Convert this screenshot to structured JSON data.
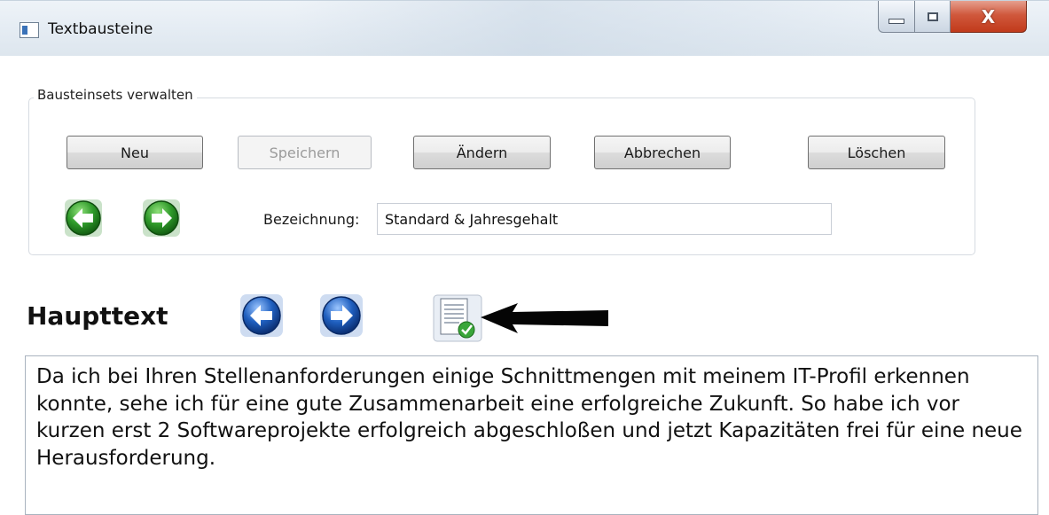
{
  "window": {
    "title": "Textbausteine",
    "close_glyph": "X"
  },
  "group": {
    "label": "Bausteinsets verwalten",
    "buttons": {
      "new": "Neu",
      "save": "Speichern",
      "edit": "Ändern",
      "cancel": "Abbrechen",
      "delete": "Löschen"
    },
    "name_label": "Bezeichnung:",
    "name_value": "Standard & Jahresgehalt",
    "nav_icons": [
      "arrow-left-green-icon",
      "arrow-right-green-icon"
    ]
  },
  "main": {
    "heading": "Haupttext",
    "nav_icons": [
      "arrow-left-blue-icon",
      "arrow-right-blue-icon"
    ],
    "doc_icon": "document-check-icon",
    "body_text": "Da ich bei Ihren Stellenanforderungen einige Schnittmengen mit meinem IT-Profil erkennen konnte, sehe ich für eine gute Zusammenarbeit eine erfolgreiche Zukunft. So habe ich vor kurzen erst 2 Softwareprojekte erfolgreich abgeschloßen und jetzt Kapazitäten frei für eine neue Herausforderung."
  },
  "colors": {
    "green": "#2f9a2a",
    "blue": "#1f5fbf",
    "close": "#c9452a"
  }
}
